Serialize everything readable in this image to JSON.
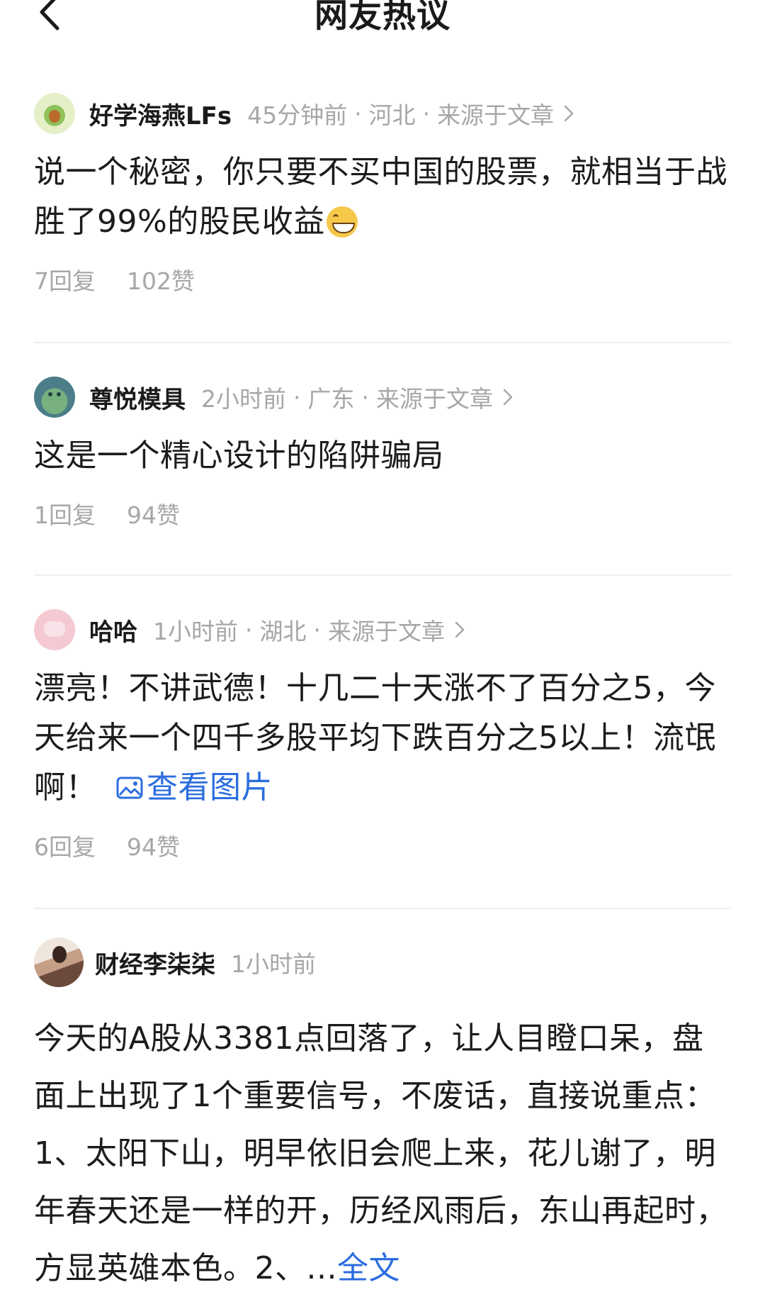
{
  "header": {
    "title": "网友热议"
  },
  "comments": [
    {
      "author": "好学海燕LFs",
      "time": "45分钟前",
      "location": "河北",
      "source": "来源于文章",
      "text": "说一个秘密，你只要不买中国的股票，就相当于战胜了99%的股民收益",
      "emoji": "grinning-face-emoji",
      "replies": "7回复",
      "likes": "102赞"
    },
    {
      "author": "尊悦模具",
      "time": "2小时前",
      "location": "广东",
      "source": "来源于文章",
      "text": "这是一个精心设计的陷阱骗局",
      "replies": "1回复",
      "likes": "94赞"
    },
    {
      "author": "哈哈",
      "time": "1小时前",
      "location": "湖北",
      "source": "来源于文章",
      "text": "漂亮！不讲武德！十几二十天涨不了百分之5，今天给来一个四千多股平均下跌百分之5以上！流氓啊！",
      "view_image_label": "查看图片",
      "replies": "6回复",
      "likes": "94赞"
    },
    {
      "author": "财经李柒柒",
      "time": "1小时前",
      "text": "今天的A股从3381点回落了，让人目瞪口呆，盘面上出现了1个重要信号，不废话，直接说重点：1、太阳下山，明早依旧会爬上来，花儿谢了，明年春天还是一样的开，历经风雨后，东山再起时，方显英雄本色。2、",
      "ellipsis": "...",
      "full_text_label": "全文"
    }
  ],
  "separator": "·",
  "colors": {
    "text_primary": "#1c1c1c",
    "text_secondary": "#a7a7a7",
    "link": "#2b6ddf",
    "divider": "#f0f0f0"
  }
}
